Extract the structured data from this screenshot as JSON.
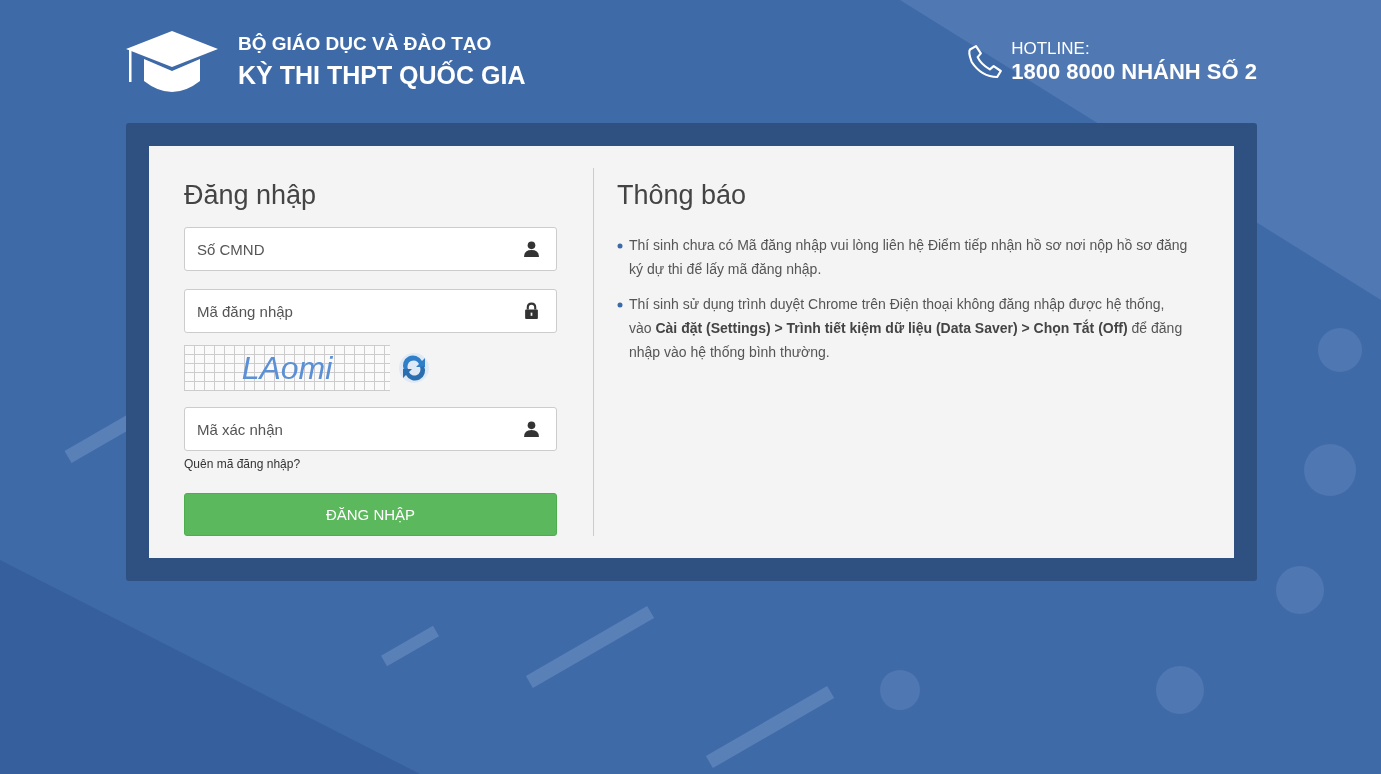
{
  "header": {
    "subtitle": "BỘ GIÁO DỤC VÀ ĐÀO TẠO",
    "title": "KỲ THI THPT QUỐC GIA",
    "hotline_label": "HOTLINE:",
    "hotline_number": "1800 8000 NHÁNH SỐ 2"
  },
  "login": {
    "title": "Đăng nhập",
    "fields": [
      {
        "placeholder": "Số CMND",
        "kind": "user"
      },
      {
        "placeholder": "Mã đăng nhập",
        "kind": "lock"
      }
    ],
    "captcha": {
      "text": "LAomi"
    },
    "code_field": {
      "placeholder": "Mã xác nhận",
      "kind": "user"
    },
    "forgot_link": "Quên mã đăng nhập?",
    "submit": "ĐĂNG NHẬP"
  },
  "notice": {
    "title": "Thông báo",
    "items": [
      "Thí sinh chưa có Mã đăng nhập vui lòng liên hệ Điểm tiếp nhận hồ sơ nơi nộp hồ sơ đăng ký dự thi để lấy mã đăng nhập.",
      "Thí sinh sử dụng trình duyệt Chrome trên Điện thoại không đăng nhập được hệ thống, vào **Cài đặt (Settings) > Trình tiết kiệm dữ liệu (Data Saver) > Chọn Tắt (Off)** để đăng nhập vào hệ thống bình thường."
    ]
  }
}
